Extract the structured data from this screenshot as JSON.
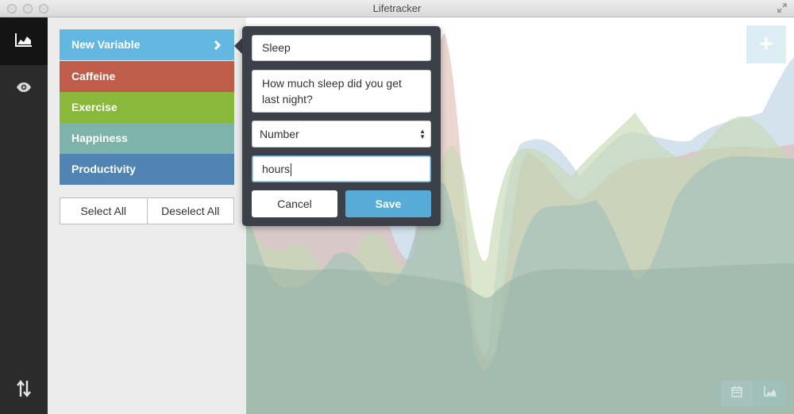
{
  "window": {
    "title": "Lifetracker"
  },
  "sidebar": {
    "items": [
      {
        "icon": "area-chart-icon",
        "active": true
      },
      {
        "icon": "eye-icon",
        "active": false
      }
    ],
    "bottom_icon": "sort-arrows-icon"
  },
  "variables": {
    "items": [
      {
        "label": "New Variable",
        "color": "#63b8e2",
        "selected": true
      },
      {
        "label": "Caffeine",
        "color": "#c05d4a"
      },
      {
        "label": "Exercise",
        "color": "#8ab83b"
      },
      {
        "label": "Happiness",
        "color": "#7db3ab"
      },
      {
        "label": "Productivity",
        "color": "#4f84b3"
      }
    ],
    "select_all_label": "Select All",
    "deselect_all_label": "Deselect All"
  },
  "popover": {
    "name_value": "Sleep",
    "question_value": "How much sleep did you get last night?",
    "type_value": "Number",
    "unit_value": "hours",
    "cancel_label": "Cancel",
    "save_label": "Save",
    "save_color": "#56acd6"
  },
  "chart": {
    "add_button_label": "+",
    "view_tabs": [
      "calendar-icon",
      "area-chart-icon"
    ]
  }
}
